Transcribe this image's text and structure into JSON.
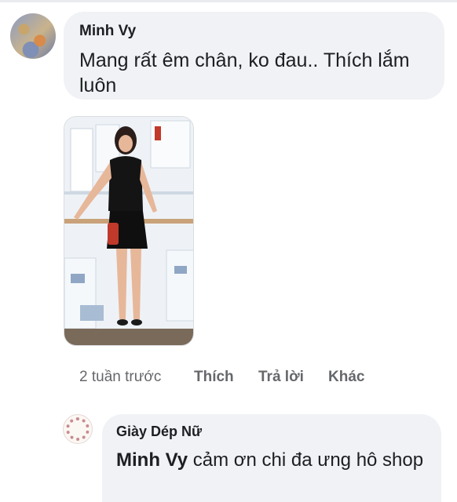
{
  "comment": {
    "author": "Minh Vy",
    "text": "Mang rất êm chân, ko đau.. Thích lắm luôn",
    "time": "2 tuần trước",
    "actions": {
      "like": "Thích",
      "reply": "Trả lời",
      "more": "Khác"
    },
    "photo_icon": "photo-attachment"
  },
  "reply": {
    "author": "Giày Dép Nữ",
    "mention": "Minh Vy",
    "text": " cảm ơn chi đa ưng hô shop"
  }
}
